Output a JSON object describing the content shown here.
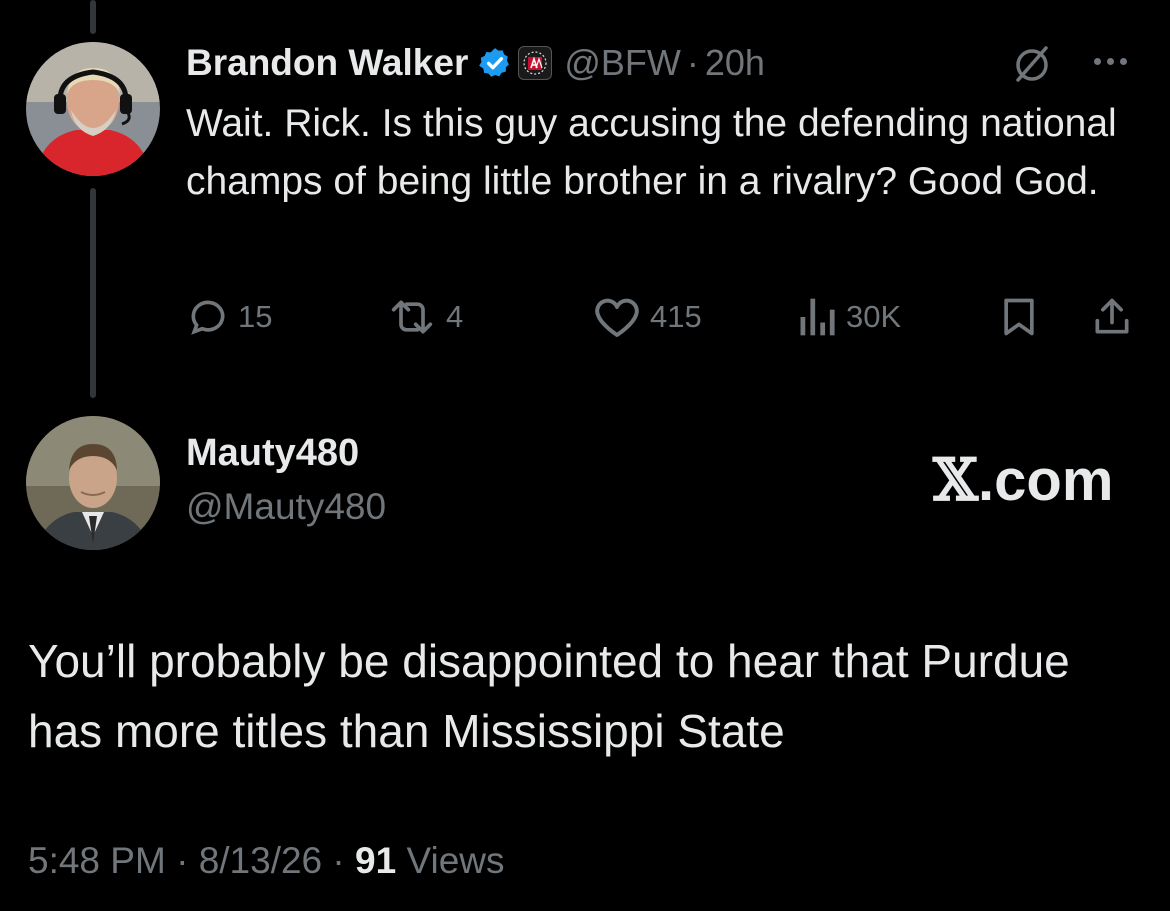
{
  "original_tweet": {
    "display_name": "Brandon Walker",
    "handle": "@BFW",
    "separator": "·",
    "time": "20h",
    "text": "Wait. Rick. Is this guy accusing the defending national champs of being little brother in a rivalry? Good God.",
    "icons": [
      "verified-badge-icon",
      "barstool-affiliate-icon",
      "grok-icon",
      "more-icon"
    ],
    "actions": {
      "replies": "15",
      "reposts": "4",
      "likes": "415",
      "views": "30K"
    }
  },
  "reply": {
    "display_name": "Mauty480",
    "handle": "@Mauty480",
    "watermark": {
      "x": "𝕏",
      "domain": ".com"
    },
    "text": "You’ll probably be disappointed to hear that Purdue has more titles than Mississippi State",
    "meta": {
      "time": "5:48 PM",
      "sep1": "·",
      "date": "8/13/26",
      "sep2": "·",
      "views_count": "91",
      "views_label": "Views"
    }
  },
  "colors": {
    "background": "#000000",
    "text_primary": "#e7e9ea",
    "text_secondary": "#71767b",
    "verified": "#1d9bf0"
  }
}
